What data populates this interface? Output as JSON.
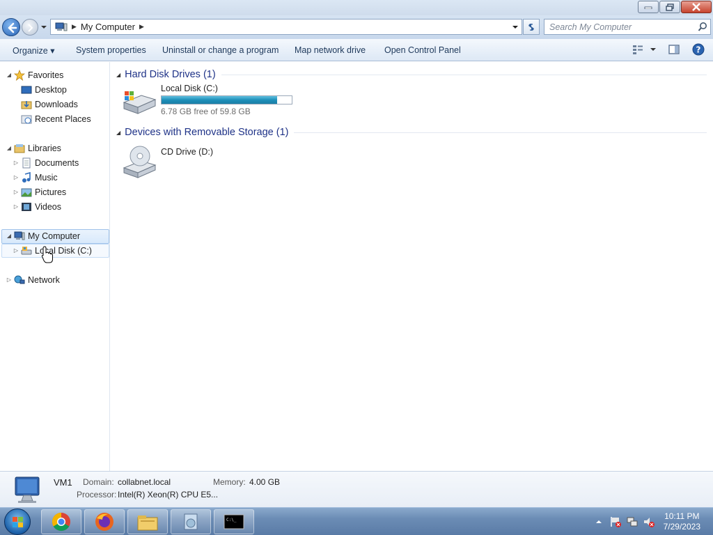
{
  "window": {
    "minimize_glyph": "—",
    "maximize_glyph": "❐",
    "close_glyph": "✕"
  },
  "address": {
    "location": "My Computer",
    "search_placeholder": "Search My Computer"
  },
  "toolbar": {
    "organize": "Organize ▾",
    "system_properties": "System properties",
    "uninstall": "Uninstall or change a program",
    "map_network_drive": "Map network drive",
    "open_control_panel": "Open Control Panel"
  },
  "navigation": {
    "favorites": "Favorites",
    "desktop": "Desktop",
    "downloads": "Downloads",
    "recent_places": "Recent Places",
    "libraries": "Libraries",
    "documents": "Documents",
    "music": "Music",
    "pictures": "Pictures",
    "videos": "Videos",
    "my_computer": "My Computer",
    "local_disk": "Local Disk (C:)",
    "network": "Network"
  },
  "content": {
    "hard_disk_header": "Hard Disk Drives (1)",
    "removable_header": "Devices with Removable Storage (1)",
    "local_disk_name": "Local Disk (C:)",
    "local_disk_free": "6.78 GB free of 59.8 GB",
    "local_disk_used_fraction": 0.887,
    "cd_drive_name": "CD Drive (D:)"
  },
  "details": {
    "computer_name": "VM1",
    "domain_label": "Domain:",
    "domain_value": "collabnet.local",
    "memory_label": "Memory:",
    "memory_value": "4.00 GB",
    "processor_label": "Processor:",
    "processor_value": "Intel(R) Xeon(R) CPU E5..."
  },
  "taskbar": {
    "time": "10:11 PM",
    "date": "7/29/2023"
  },
  "icons": {
    "back": "back-arrow-icon",
    "forward": "forward-arrow-icon",
    "computer": "computer-icon",
    "drive": "hard-drive-icon",
    "cd": "cd-drive-icon"
  }
}
